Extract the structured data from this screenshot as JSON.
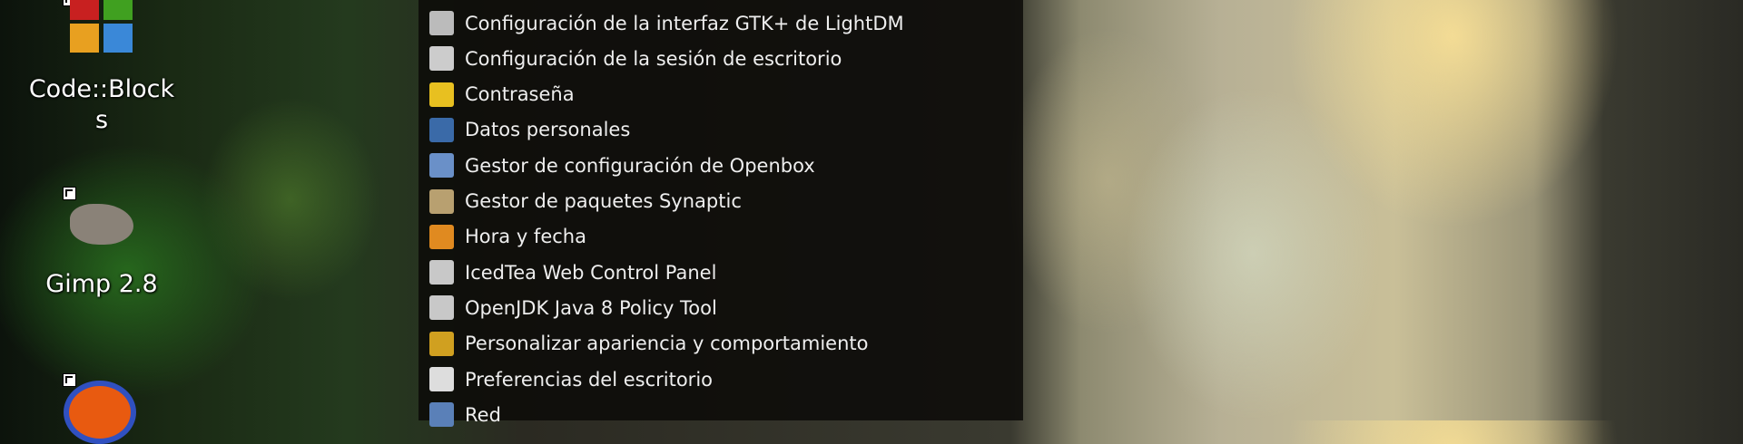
{
  "desktop": {
    "icons": [
      {
        "label": "Code::Blocks"
      },
      {
        "label": "Gimp 2.8"
      },
      {
        "label": ""
      }
    ]
  },
  "menu": {
    "items": [
      {
        "label": "Configuración de la interfaz GTK+ de LightDM",
        "icon": "lightdm-settings-icon",
        "color": "#bbbbbb"
      },
      {
        "label": "Configuración de la sesión de escritorio",
        "icon": "session-settings-icon",
        "color": "#cccccc"
      },
      {
        "label": "Contraseña",
        "icon": "lock-icon",
        "color": "#e8c020"
      },
      {
        "label": "Datos personales",
        "icon": "user-icon",
        "color": "#3a6aa8"
      },
      {
        "label": "Gestor de configuración de Openbox",
        "icon": "openbox-icon",
        "color": "#6a90c8"
      },
      {
        "label": "Gestor de paquetes Synaptic",
        "icon": "package-icon",
        "color": "#b8a070"
      },
      {
        "label": "Hora y fecha",
        "icon": "clock-icon",
        "color": "#e08a20"
      },
      {
        "label": "IcedTea Web Control Panel",
        "icon": "java-icon",
        "color": "#c8c8c8"
      },
      {
        "label": "OpenJDK Java 8 Policy Tool",
        "icon": "java-icon",
        "color": "#c8c8c8"
      },
      {
        "label": "Personalizar apariencia y comportamiento",
        "icon": "brush-icon",
        "color": "#d0a020"
      },
      {
        "label": "Preferencias del escritorio",
        "icon": "desktop-prefs-icon",
        "color": "#dddddd"
      },
      {
        "label": "Red",
        "icon": "network-icon",
        "color": "#5a80b8"
      }
    ]
  }
}
